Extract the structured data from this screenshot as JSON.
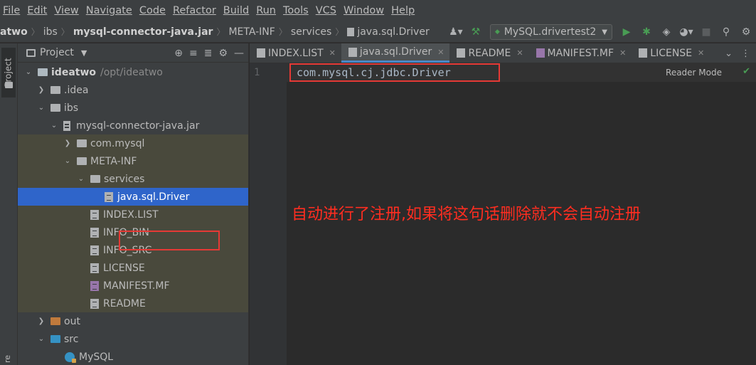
{
  "menu": [
    "File",
    "Edit",
    "View",
    "Navigate",
    "Code",
    "Refactor",
    "Build",
    "Run",
    "Tools",
    "VCS",
    "Window",
    "Help"
  ],
  "breadcrumb": [
    "atwo",
    "ibs",
    "mysql-connector-java.jar",
    "META-INF",
    "services",
    "java.sql.Driver"
  ],
  "run_config": "MySQL.drivertest2",
  "left_strip": {
    "project_tab": "Project",
    "bottom_label": "re"
  },
  "project_panel": {
    "title": "Project",
    "tree": [
      {
        "label": "ideatwo",
        "path": "/opt/ideatwo"
      },
      {
        "label": ".idea"
      },
      {
        "label": "ibs"
      },
      {
        "label": "mysql-connector-java.jar"
      },
      {
        "label": "com.mysql"
      },
      {
        "label": "META-INF"
      },
      {
        "label": "services"
      },
      {
        "label": "java.sql.Driver"
      },
      {
        "label": "INDEX.LIST"
      },
      {
        "label": "INFO_BIN"
      },
      {
        "label": "INFO_SRC"
      },
      {
        "label": "LICENSE"
      },
      {
        "label": "MANIFEST.MF"
      },
      {
        "label": "README"
      },
      {
        "label": "out"
      },
      {
        "label": "src"
      },
      {
        "label": "MySQL"
      }
    ]
  },
  "editor": {
    "tabs": [
      "INDEX.LIST",
      "java.sql.Driver",
      "README",
      "MANIFEST.MF",
      "LICENSE"
    ],
    "active_tab": "java.sql.Driver",
    "line_number": "1",
    "code_line": "com.mysql.cj.jdbc.Driver",
    "reader_mode": "Reader Mode"
  },
  "annotation": "自动进行了注册,如果将这句话删除就不会自动注册",
  "colors": {
    "accent": "#2f65ca",
    "highlight_box": "#e53935",
    "annotation": "#ff2d20",
    "library_bg": "#49493c"
  }
}
